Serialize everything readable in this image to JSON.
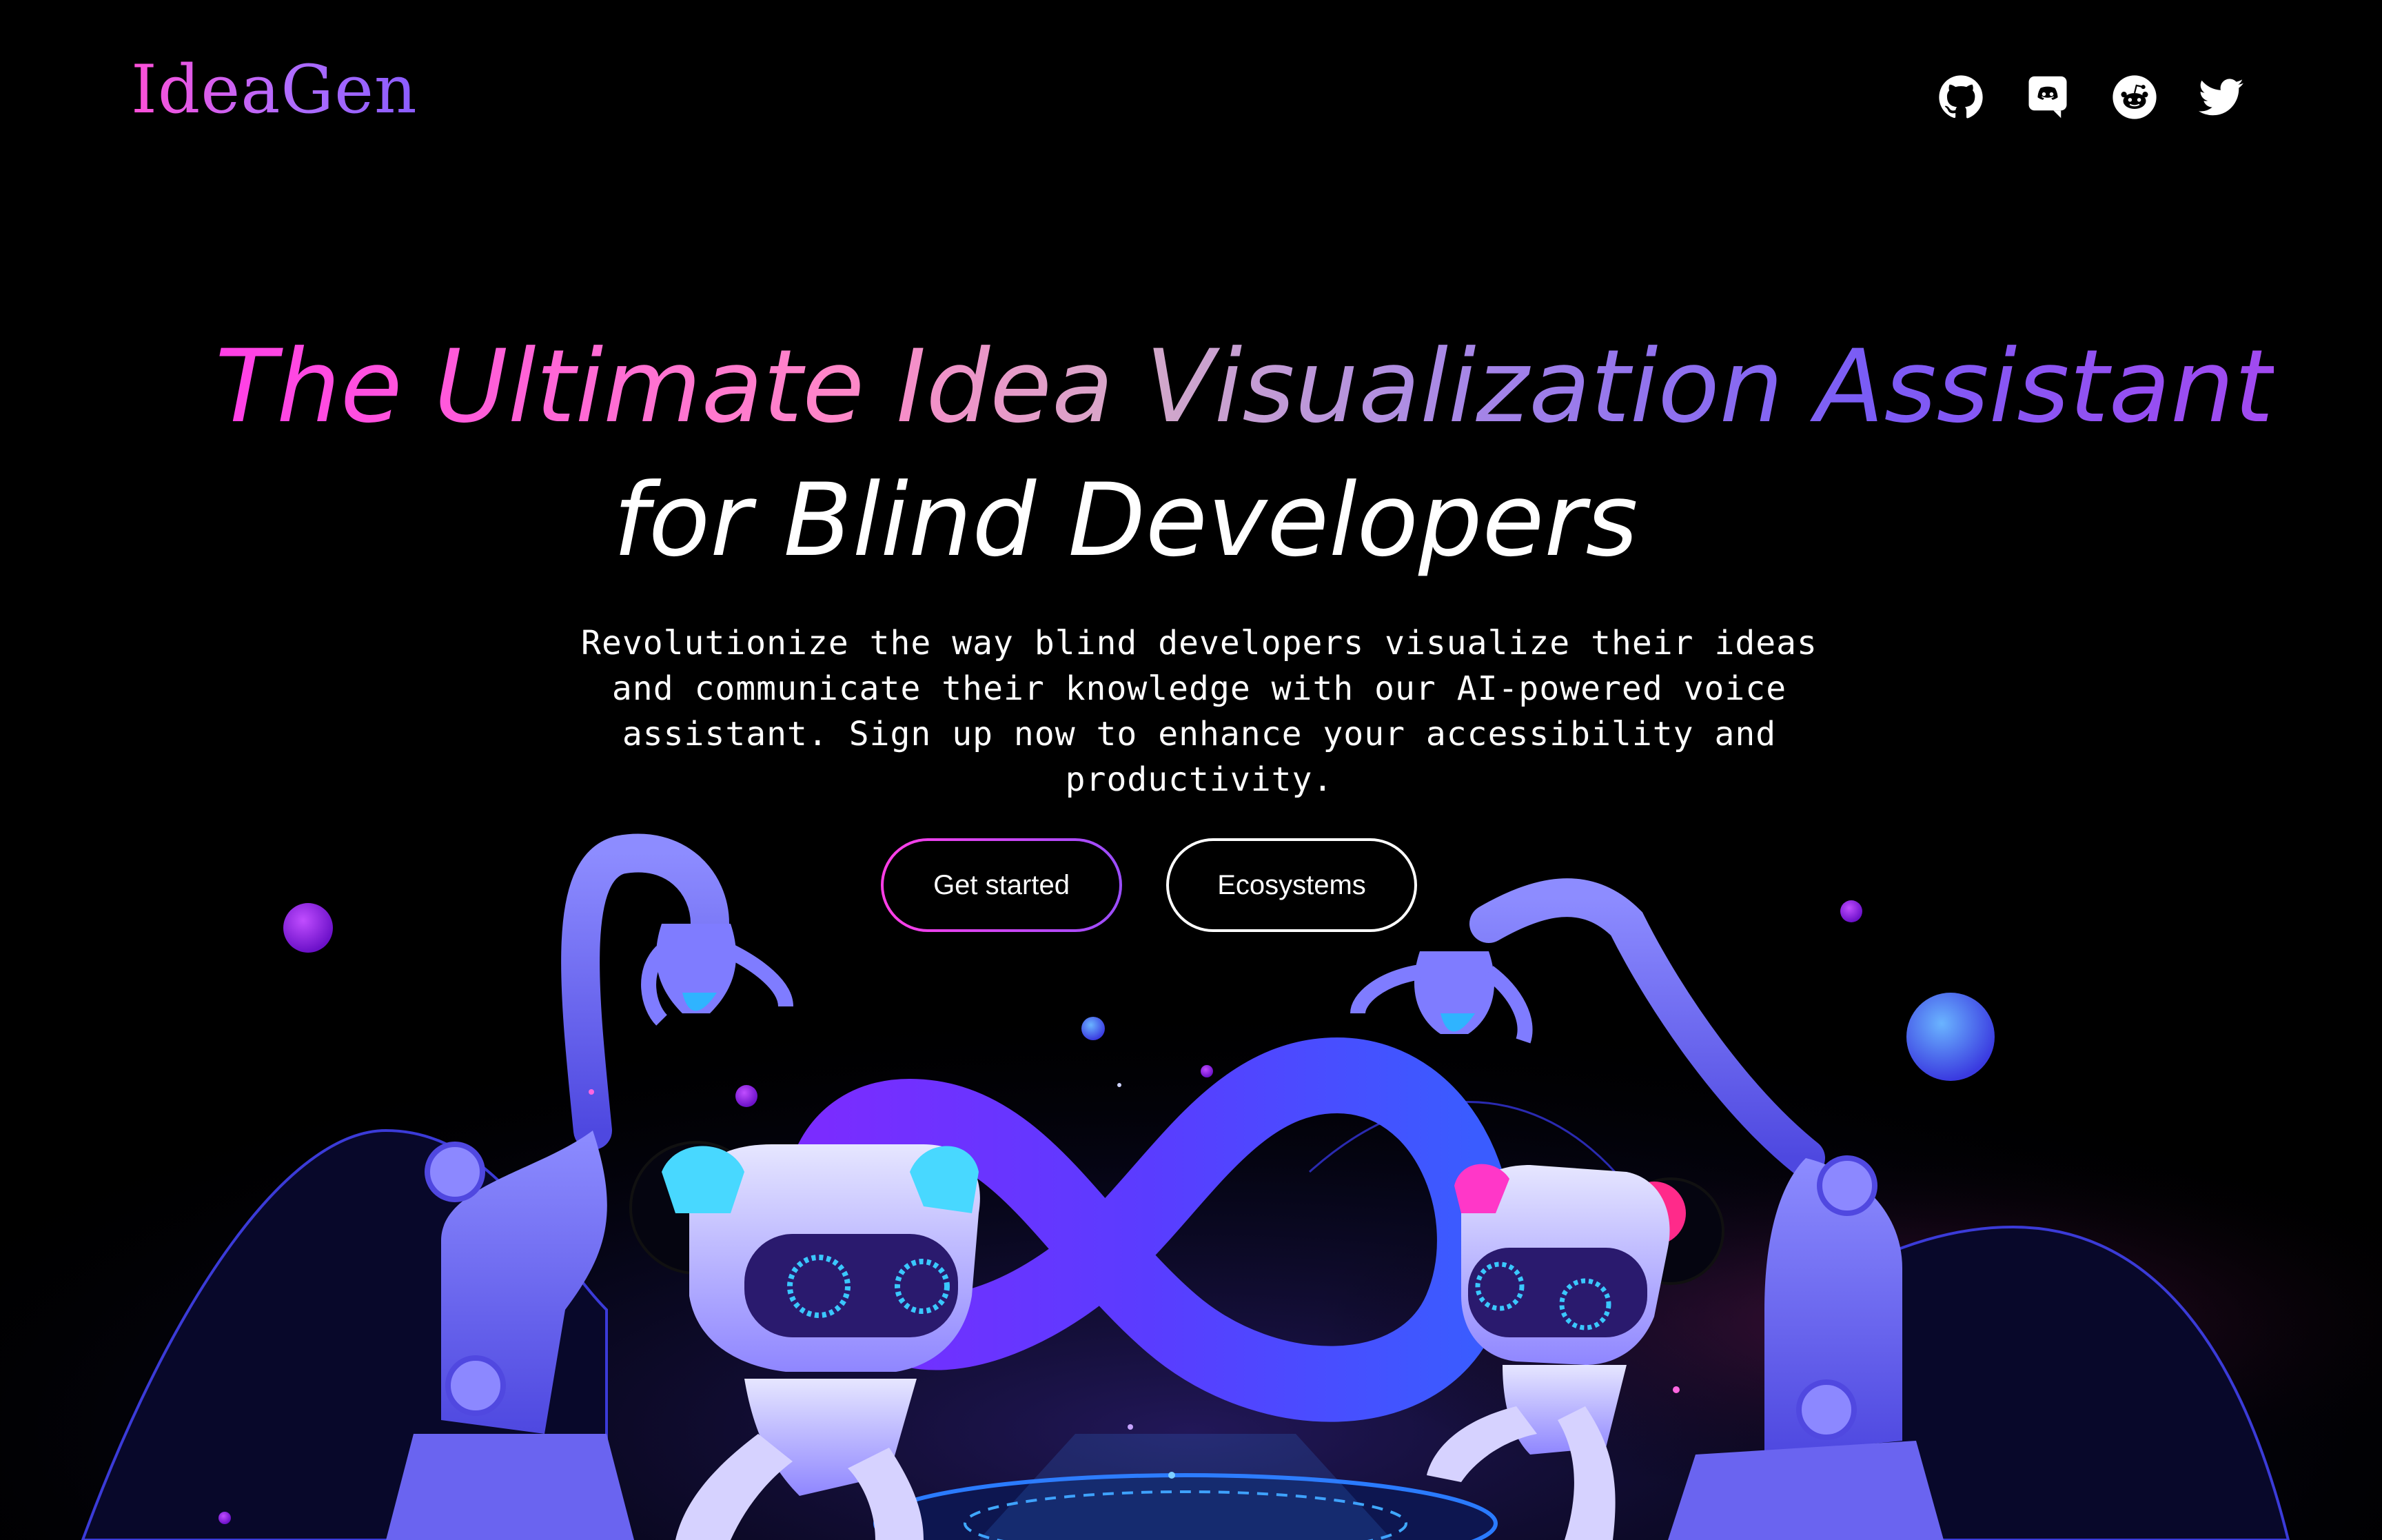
{
  "brand": {
    "logo_text": "IdeaGen"
  },
  "nav": {
    "social_icons": [
      "github-icon",
      "discord-icon",
      "reddit-icon",
      "twitter-icon"
    ]
  },
  "hero": {
    "headline_line1": "The Ultimate Idea Visualization Assistant",
    "headline_line2": "for Blind Developers",
    "subtitle": "Revolutionize the way blind developers visualize their ideas and communicate their knowledge with our AI-powered voice assistant. Sign up now to enhance your accessibility and productivity.",
    "primary_button": "Get started",
    "secondary_button": "Ecosystems"
  },
  "colors": {
    "background": "#000000",
    "accent_pink": "#ff3ee6",
    "accent_purple": "#8a5cff",
    "accent_blue": "#3c5cff"
  }
}
